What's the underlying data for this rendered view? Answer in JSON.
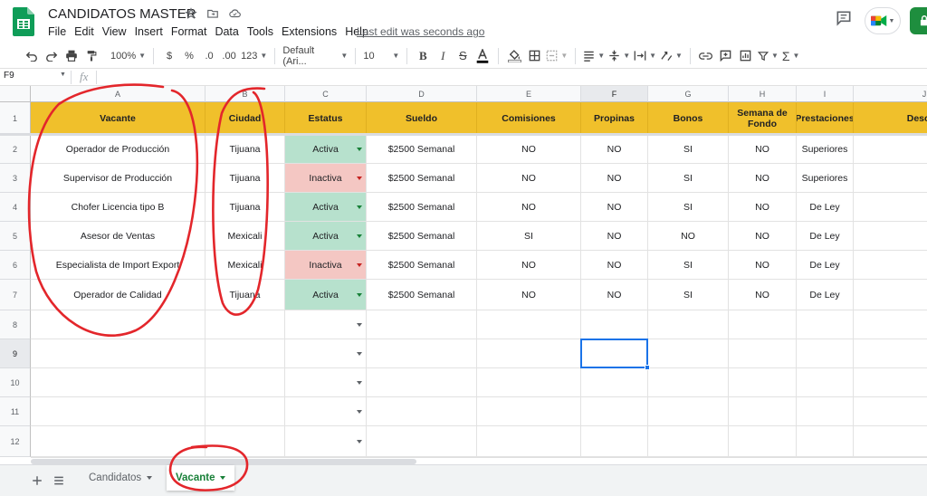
{
  "doc": {
    "title": "CANDIDATOS MASTER",
    "last_edit": "Last edit was seconds ago"
  },
  "menu": [
    "File",
    "Edit",
    "View",
    "Insert",
    "Format",
    "Data",
    "Tools",
    "Extensions",
    "Help"
  ],
  "toolbar": {
    "zoom": "100%",
    "currency": "$",
    "percent": "%",
    "dec_less": ".0",
    "dec_more": ".00",
    "more_formats": "123",
    "font": "Default (Ari...",
    "font_size": "10"
  },
  "formula": {
    "name_box": "F9",
    "fx_label": "fx"
  },
  "columns": [
    "A",
    "B",
    "C",
    "D",
    "E",
    "F",
    "G",
    "H",
    "I",
    "J"
  ],
  "row_numbers": [
    "1",
    "2",
    "3",
    "4",
    "5",
    "6",
    "7",
    "8",
    "9",
    "10",
    "11",
    "12"
  ],
  "headers": [
    "Vacante",
    "Ciudad",
    "Estatus",
    "Sueldo",
    "Comisiones",
    "Propinas",
    "Bonos",
    "Semana de Fondo",
    "Prestaciones",
    "Descrip"
  ],
  "rows": [
    [
      "Operador de Producción",
      "Tijuana",
      "Activa",
      "$2500 Semanal",
      "NO",
      "NO",
      "SI",
      "NO",
      "Superiores",
      ""
    ],
    [
      "Supervisor de Producción",
      "Tijuana",
      "Inactiva",
      "$2500 Semanal",
      "NO",
      "NO",
      "SI",
      "NO",
      "Superiores",
      ""
    ],
    [
      "Chofer Licencia tipo B",
      "Tijuana",
      "Activa",
      "$2500 Semanal",
      "NO",
      "NO",
      "SI",
      "NO",
      "De Ley",
      ""
    ],
    [
      "Asesor de Ventas",
      "Mexicali",
      "Activa",
      "$2500 Semanal",
      "SI",
      "NO",
      "NO",
      "NO",
      "De Ley",
      ""
    ],
    [
      "Especialista de Import Export",
      "Mexicali",
      "Inactiva",
      "$2500 Semanal",
      "NO",
      "NO",
      "SI",
      "NO",
      "De Ley",
      ""
    ],
    [
      "Operador de Calidad",
      "Tijuana",
      "Activa",
      "$2500 Semanal",
      "NO",
      "NO",
      "SI",
      "NO",
      "De Ley",
      ""
    ]
  ],
  "sheets": [
    {
      "label": "Candidatos",
      "current": false
    },
    {
      "label": "Vacante",
      "current": true
    }
  ],
  "colors": {
    "header_fill": "#f0c02b",
    "active_chip": "#b7e1cd",
    "inactive_chip": "#f4c7c3",
    "selection": "#1a73e8",
    "annotation": "#e3262b",
    "current_tab": "#188038"
  },
  "icons": [
    "sheets-logo",
    "star-icon",
    "folder-move-icon",
    "cloud-status-icon",
    "comment-history-icon",
    "meet-icon",
    "lock-icon"
  ]
}
